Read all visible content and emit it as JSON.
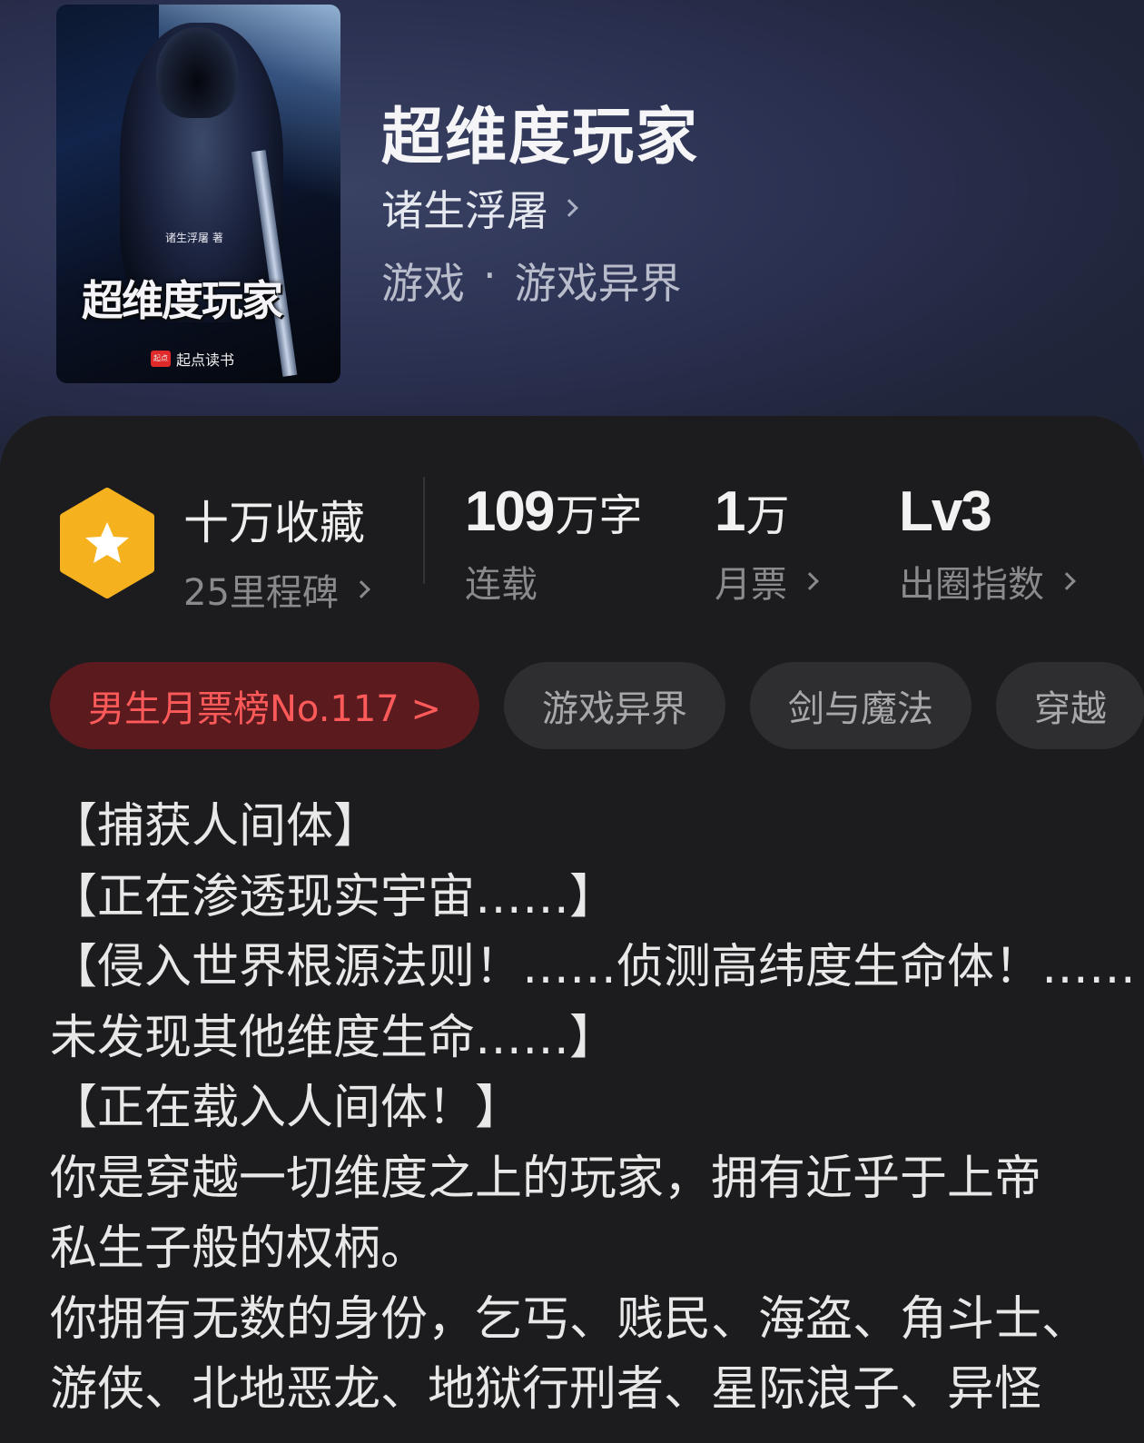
{
  "book": {
    "title": "超维度玩家",
    "author": "诸生浮屠",
    "genre": "游戏",
    "genre_separator": "·",
    "subgenre": "游戏异界"
  },
  "cover": {
    "author_line": "诸生浮屠 著",
    "title": "超维度玩家",
    "brand_mark": "起点",
    "brand": "起点读书"
  },
  "stats": {
    "collect_main": "十万收藏",
    "collect_sub": "25里程碑",
    "words_num": "109",
    "words_unit": "万字",
    "words_label": "连载",
    "tickets_num": "1",
    "tickets_unit": "万",
    "tickets_label": "月票",
    "level_value": "Lv3",
    "level_label": "出圈指数"
  },
  "tags": {
    "rank": "男生月票榜No.117 >",
    "items": [
      "游戏异界",
      "剑与魔法",
      "穿越"
    ]
  },
  "description": [
    "【捕获人间体】",
    "【正在渗透现实宇宙……】",
    "【侵入世界根源法则！……侦测高纬度生命体！……",
    "未发现其他维度生命……】",
    "【正在载入人间体！】",
    "你是穿越一切维度之上的玩家，拥有近乎于上帝",
    "私生子般的权柄。",
    "你拥有无数的身份，乞丐、贱民、海盗、角斗士、",
    "游侠、北地恶龙、地狱行刑者、星际浪子、异怪"
  ],
  "colors": {
    "hero_bg": "#2a3050",
    "panel_bg": "#1c1c1e",
    "badge": "#f5b21e",
    "rank_text": "#ff5a5a",
    "rank_bg": "#5a1a1e"
  },
  "icons": [
    "star-hexagon-icon",
    "chevron-right-icon"
  ]
}
